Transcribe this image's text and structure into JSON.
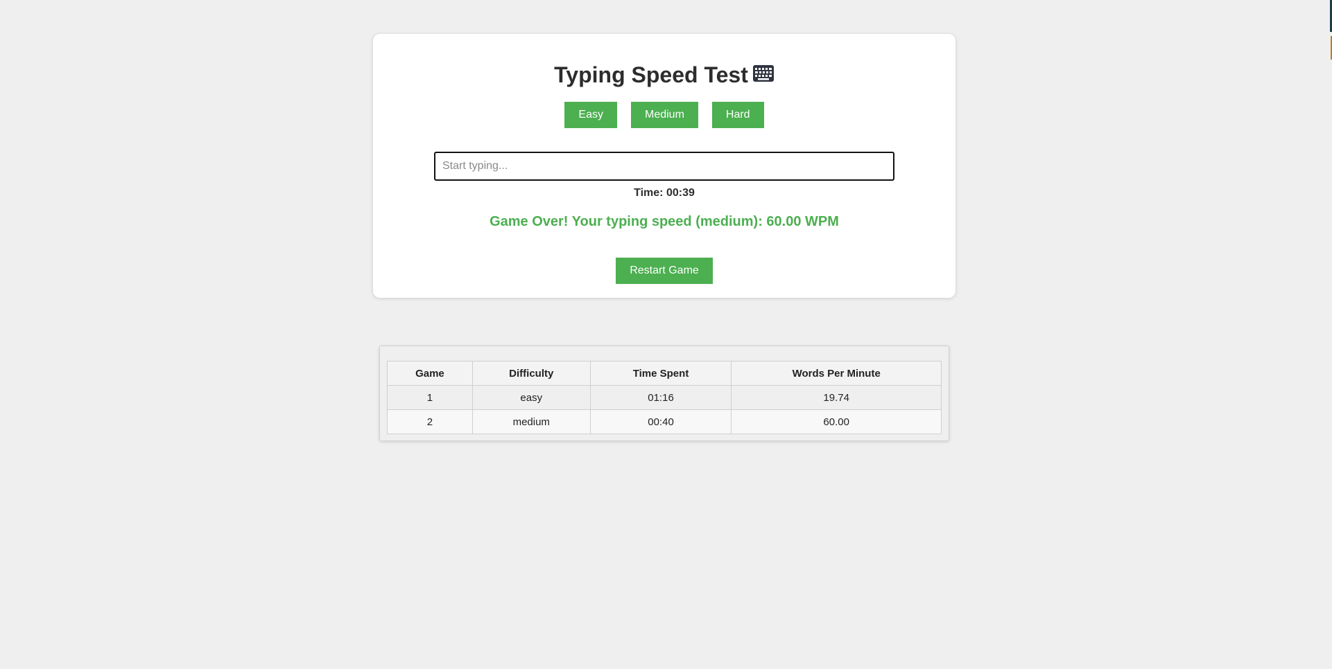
{
  "app": {
    "title": "Typing Speed Test",
    "title_icon": "keyboard-icon"
  },
  "difficulty": {
    "easy_label": "Easy",
    "medium_label": "Medium",
    "hard_label": "Hard"
  },
  "input": {
    "placeholder": "Start typing...",
    "value": ""
  },
  "timer": {
    "text": "Time: 00:39"
  },
  "result": {
    "text": "Game Over! Your typing speed (medium): 60.00 WPM"
  },
  "restart": {
    "label": "Restart Game"
  },
  "history": {
    "headers": [
      "Game",
      "Difficulty",
      "Time Spent",
      "Words Per Minute"
    ],
    "rows": [
      [
        "1",
        "easy",
        "01:16",
        "19.74"
      ],
      [
        "2",
        "medium",
        "00:40",
        "60.00"
      ]
    ]
  },
  "colors": {
    "accent": "#4caf50",
    "background": "#efefef",
    "card": "#ffffff"
  }
}
